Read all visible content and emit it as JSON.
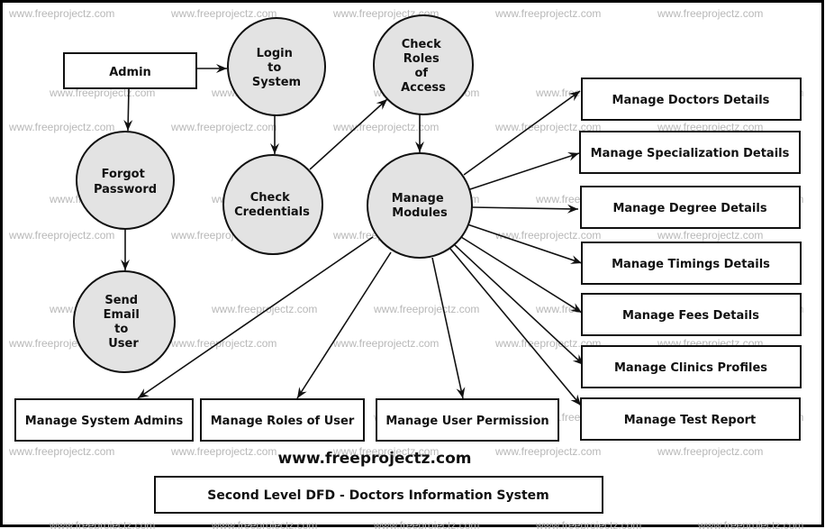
{
  "diagram": {
    "title": "Second Level DFD - Doctors Information System",
    "site_label": "www.freeprojectz.com",
    "watermark": "www.freeprojectz.com",
    "colors": {
      "process_fill": "#e3e3e3",
      "stroke": "#111111",
      "watermark": "#b8b8b8"
    },
    "entities": [
      {
        "id": "admin",
        "label": "Admin"
      }
    ],
    "processes": [
      {
        "id": "login",
        "lines": [
          "Login",
          "to",
          "System"
        ]
      },
      {
        "id": "check_roles",
        "lines": [
          "Check",
          "Roles",
          "of",
          "Access"
        ]
      },
      {
        "id": "forgot",
        "lines": [
          "Forgot",
          "Password"
        ]
      },
      {
        "id": "check_cred",
        "lines": [
          "Check",
          "Credentials"
        ]
      },
      {
        "id": "manage_modules",
        "lines": [
          "Manage",
          "Modules"
        ]
      },
      {
        "id": "send_email",
        "lines": [
          "Send",
          "Email",
          "to",
          "User"
        ]
      }
    ],
    "modules": [
      {
        "id": "doctors",
        "label": "Manage Doctors Details"
      },
      {
        "id": "specialization",
        "label": "Manage Specialization Details"
      },
      {
        "id": "degree",
        "label": "Manage Degree Details"
      },
      {
        "id": "timings",
        "label": "Manage Timings Details"
      },
      {
        "id": "fees",
        "label": "Manage Fees Details"
      },
      {
        "id": "clinics",
        "label": "Manage Clinics Profiles"
      },
      {
        "id": "test_report",
        "label": "Manage Test Report"
      },
      {
        "id": "system_admins",
        "label": "Manage System Admins"
      },
      {
        "id": "roles",
        "label": "Manage Roles of User"
      },
      {
        "id": "permission",
        "label": "Manage User Permission"
      }
    ],
    "flows": [
      [
        "admin",
        "login"
      ],
      [
        "admin",
        "forgot"
      ],
      [
        "login",
        "check_cred"
      ],
      [
        "check_cred",
        "check_roles"
      ],
      [
        "check_roles",
        "manage_modules"
      ],
      [
        "forgot",
        "send_email"
      ],
      [
        "manage_modules",
        "doctors"
      ],
      [
        "manage_modules",
        "specialization"
      ],
      [
        "manage_modules",
        "degree"
      ],
      [
        "manage_modules",
        "timings"
      ],
      [
        "manage_modules",
        "fees"
      ],
      [
        "manage_modules",
        "clinics"
      ],
      [
        "manage_modules",
        "test_report"
      ],
      [
        "manage_modules",
        "system_admins"
      ],
      [
        "manage_modules",
        "roles"
      ],
      [
        "manage_modules",
        "permission"
      ]
    ]
  }
}
